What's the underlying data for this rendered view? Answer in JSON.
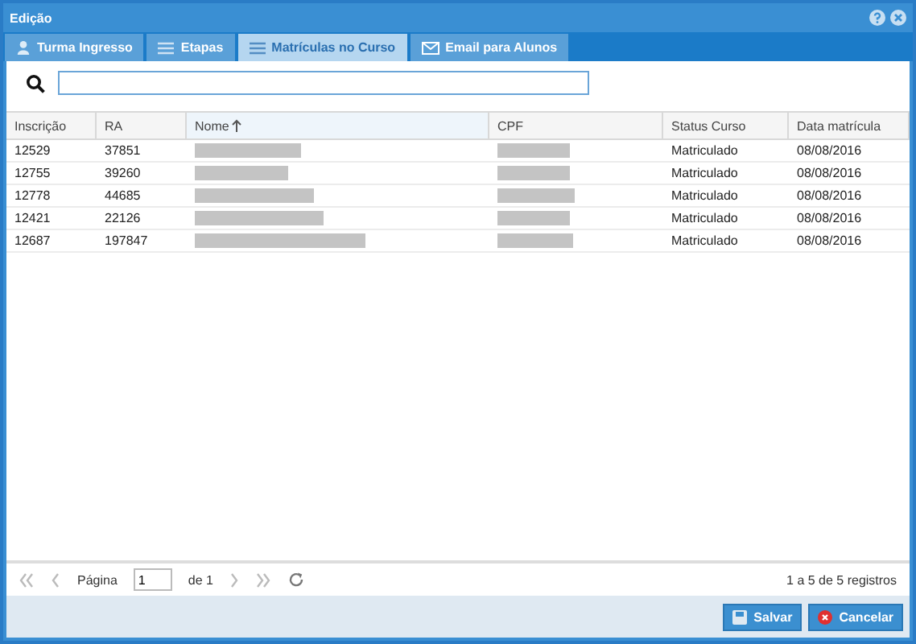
{
  "window": {
    "title": "Edição"
  },
  "tabs": [
    {
      "label": "Turma Ingresso",
      "kind": "user",
      "selected": false
    },
    {
      "label": "Etapas",
      "kind": "list",
      "selected": false
    },
    {
      "label": "Matrículas no Curso",
      "kind": "list",
      "selected": true
    },
    {
      "label": "Email para Alunos",
      "kind": "mail",
      "selected": false
    }
  ],
  "table": {
    "columns": [
      {
        "label": "Inscrição",
        "sorted": false
      },
      {
        "label": "RA",
        "sorted": false
      },
      {
        "label": "Nome",
        "sorted": true
      },
      {
        "label": "CPF",
        "sorted": false
      },
      {
        "label": "Status Curso",
        "sorted": false
      },
      {
        "label": "Data matrícula",
        "sorted": false
      }
    ],
    "rows": [
      {
        "inscricao": "12529",
        "ra": "37851",
        "status": "Matriculado",
        "data": "08/08/2016"
      },
      {
        "inscricao": "12755",
        "ra": "39260",
        "status": "Matriculado",
        "data": "08/08/2016"
      },
      {
        "inscricao": "12778",
        "ra": "44685",
        "status": "Matriculado",
        "data": "08/08/2016"
      },
      {
        "inscricao": "12421",
        "ra": "22126",
        "status": "Matriculado",
        "data": "08/08/2016"
      },
      {
        "inscricao": "12687",
        "ra": "197847",
        "status": "Matriculado",
        "data": "08/08/2016"
      }
    ]
  },
  "pager": {
    "page_label": "Página",
    "page": "1",
    "of": "de 1",
    "summary": "1 a 5 de 5 registros"
  },
  "buttons": [
    {
      "label": "Salvar",
      "kind": "save"
    },
    {
      "label": "Cancelar",
      "kind": "cancel"
    }
  ]
}
